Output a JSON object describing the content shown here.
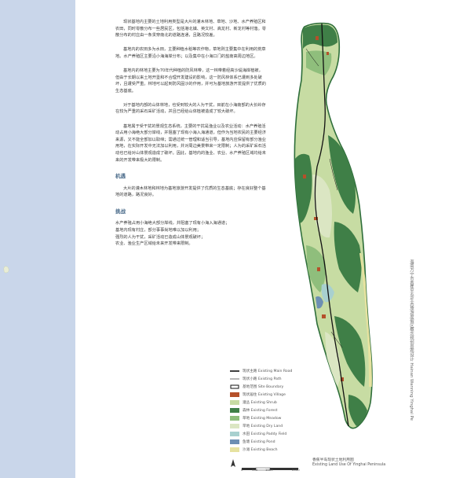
{
  "intro_paragraphs": [
    "现状基地内主要的土地利用类型是大片的灌木林地、草地、沙地、水产养殖区和农田，同时零散分布一些居民区，包括港北镇、英文村、高龙村、新龙村等村落。零散分布的村庄由一条贯穿南北的道路连通，且路况较差。",
    "基地内的农田多为水田，主要种植水稻等农作物，草地则主要集中在利用的荒草地。水产养殖区主要沿小海海岸分布；以及集中在小海口门的盐南高周边地区。",
    "基地内的林地主要为70年代种植的防风林带，这一林带着经高沙堤海岸植被，但由于长期以来土地开垦和不合理开发建设的影响，这一防风林体系已遭到多处破坏，且遭受严重。林地可以起到防风固沙的作用，并可为基地旅游开发提供了优质的生态基底。",
    "对于基地内部的山体林地，也受到较大的人为干扰，目前在小海南部的大长岭存在较为严重的采石采矿活动，并且已经给山体植被造成了较大破坏。",
    "基地属于受干扰的景观生态系统，主要的干扰是渔业以及农业活动：水产养殖活动占用小海绝大部分岸线，并阻塞了现有小海入海通道，但作为当地农民的主要经济来源，又不能全部加以取缔；需通过统一管理和适当引导，基地内应保留有部分渔业用地，在实际开发中无法加以利用，并对周边美景带来一定限制；人为的采矿采石活动也已给对山体景观造成了破坏。因此，基地内的渔业、农业、水产养殖区域均给未来的开发带来极大的限制。"
  ],
  "opportunity_heading": "机遇",
  "opportunity_text": "大片的灌木林地和林地为基地旅游开发提供了优质的生态基底；存在良好整个基地的道路，路况良好。",
  "challenge_heading": "挑战",
  "challenge_lines": [
    "水产养殖占用小海绝大部分岸线，并阻塞了现有小海入海通道；",
    "基地内现有村庄，部分事事尚地难以加以利用；",
    "强烈的人为干扰，采矿活动已造成山体景观破坏；",
    "农业、渔业生产区域给未来开发带来限制。"
  ],
  "legend": [
    {
      "key": "main-road",
      "label": "现状主路 Existing Main Road",
      "symbol": "line-thick"
    },
    {
      "key": "path",
      "label": "现状小路 Existing Path",
      "symbol": "line-thin"
    },
    {
      "key": "boundary",
      "label": "基地范围 Site Boundary",
      "symbol": "line-box"
    },
    {
      "key": "village",
      "label": "现状居住 Existing Village",
      "color": "#b5502a"
    },
    {
      "key": "shrub",
      "label": "灌丛 Existing Shrub",
      "color": "#c7dca3"
    },
    {
      "key": "forest",
      "label": "森林 Existing Forest",
      "color": "#3f7f47"
    },
    {
      "key": "meadow",
      "label": "草地 Existing Meadow",
      "color": "#8fbe7c"
    },
    {
      "key": "dry-land",
      "label": "旱地 Existing Dry Land",
      "color": "#dbe6c3"
    },
    {
      "key": "paddy",
      "label": "水田 Existing Paddy Field",
      "color": "#a8d0cf"
    },
    {
      "key": "pond",
      "label": "鱼塘 Existing Pond",
      "color": "#6d8fb3"
    },
    {
      "key": "beach",
      "label": "沙滩 Existing Beach",
      "color": "#e6e2a0"
    }
  ],
  "map_title_cn": "香蕉半岛现状土地利用图",
  "map_title_en": "Existing Land Use Of Yinghai Peninsula",
  "side_title_cn": "海南万宁市香蕉半岛生态旅游度假区概念规划景观设计",
  "side_title_en": "Hainan Wanning Yinghai Pe",
  "scale_labels": [
    "0",
    "500",
    "1000",
    "2000"
  ],
  "colors": {
    "left_band": "#c9d6ea",
    "heading": "#4a6b8a"
  }
}
